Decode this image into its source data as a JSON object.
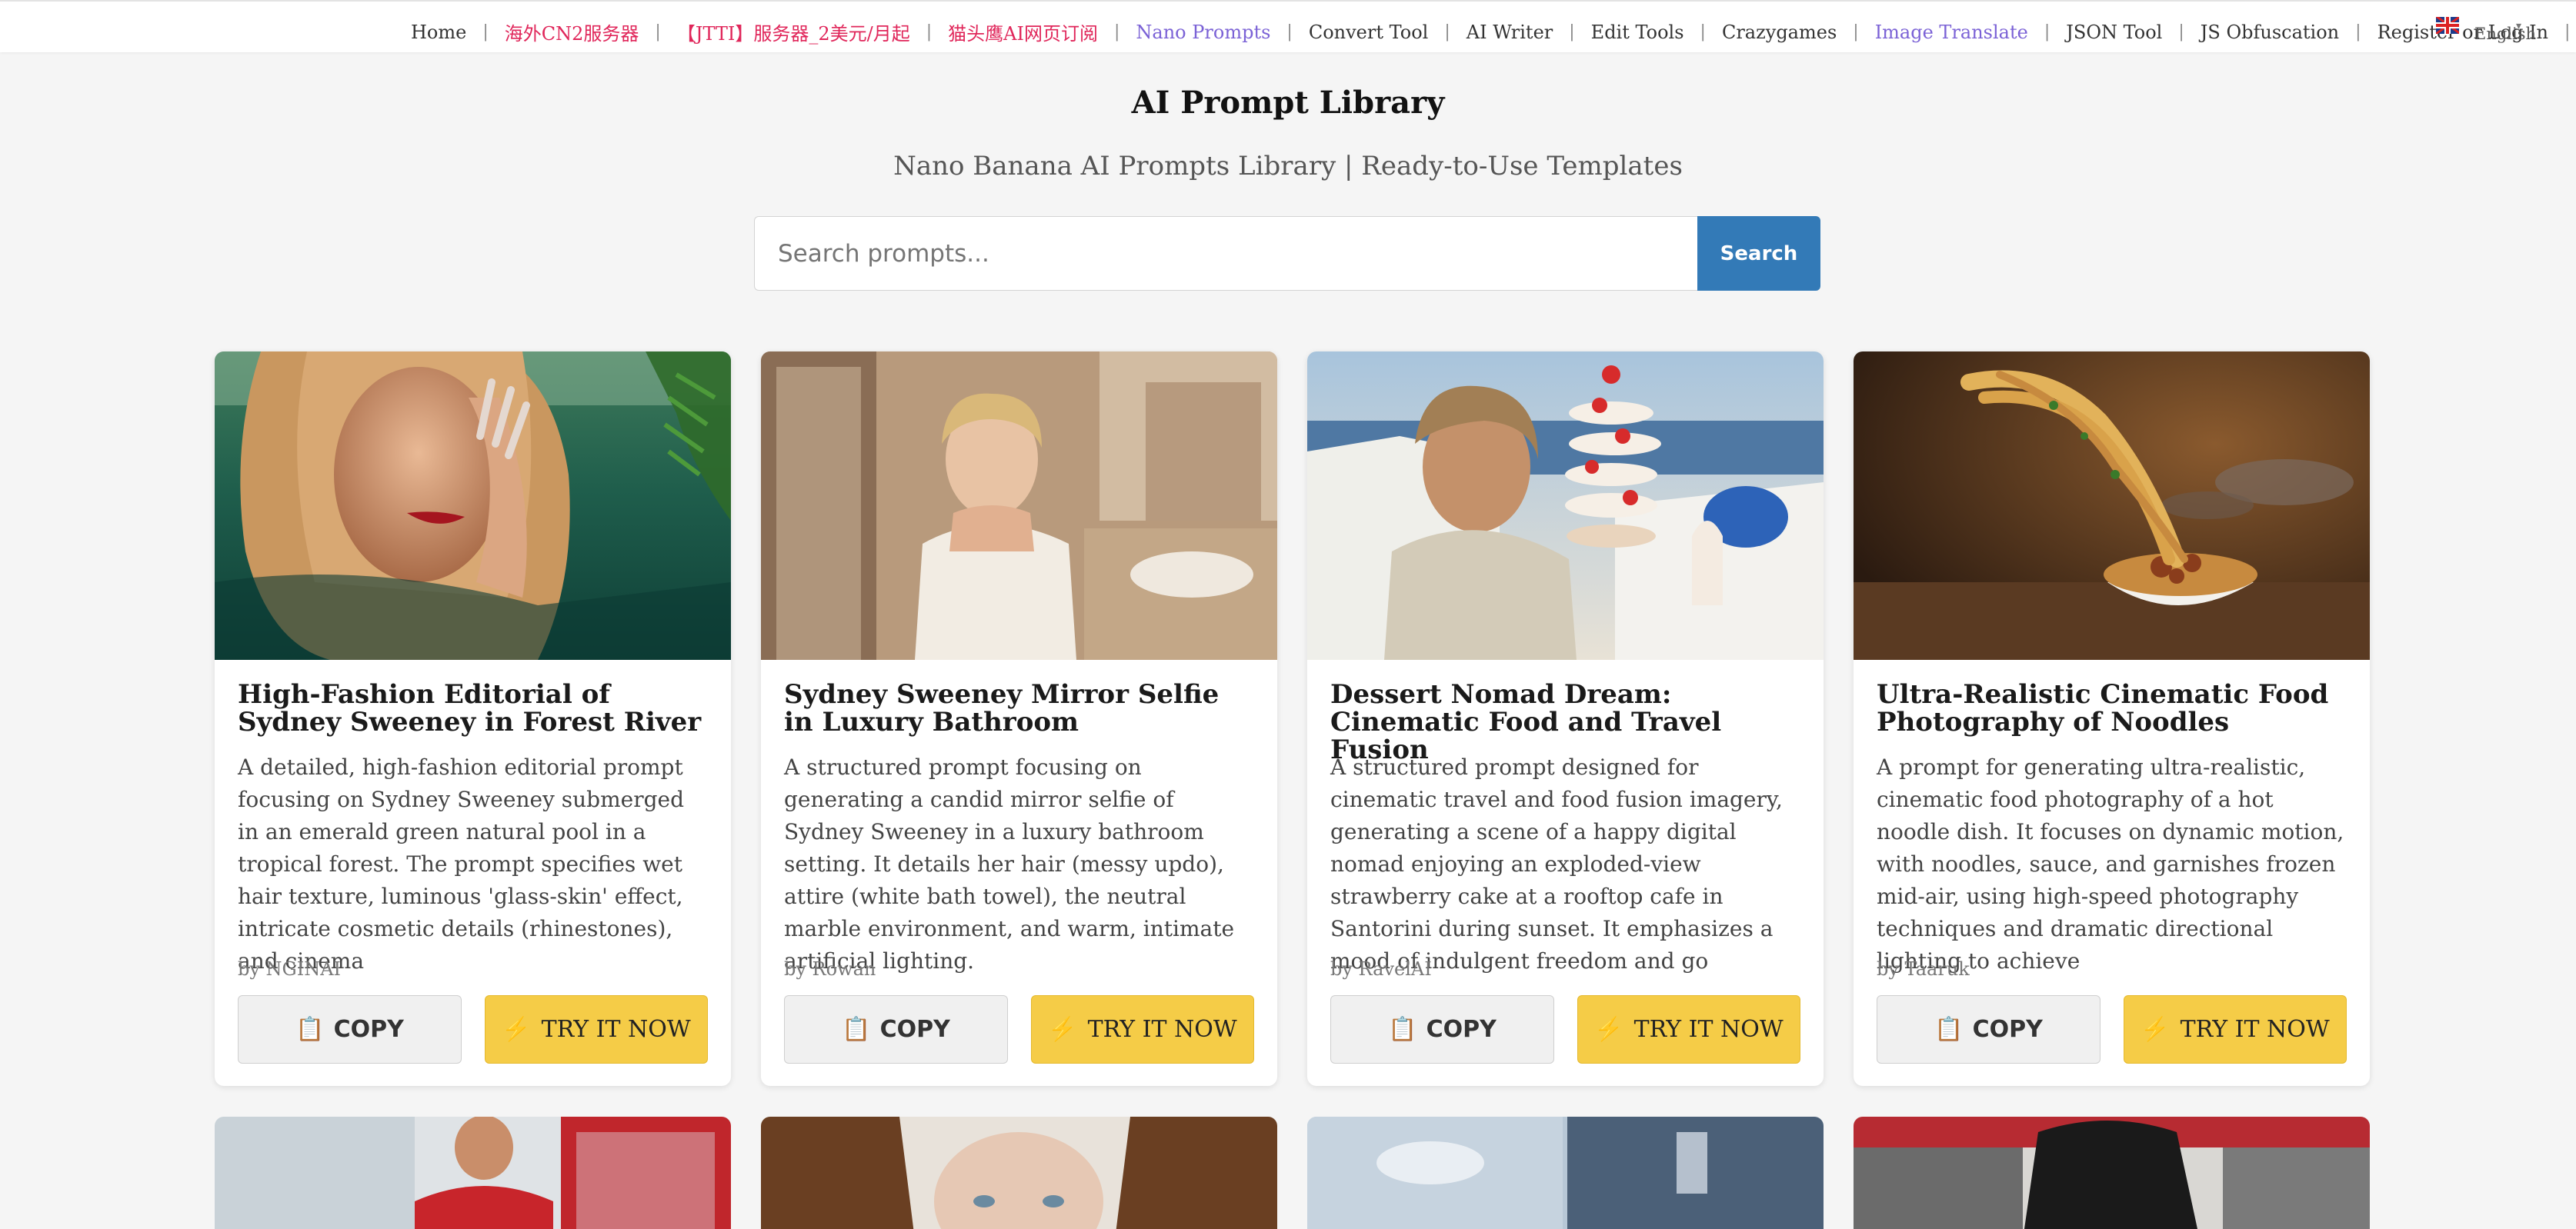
{
  "nav": {
    "items": [
      {
        "label": "Home",
        "style": "normal"
      },
      {
        "label": "海外CN2服务器",
        "style": "red"
      },
      {
        "label": "【JTTI】服务器_2美元/月起",
        "style": "red"
      },
      {
        "label": "猫头鹰AI网页订阅",
        "style": "red"
      },
      {
        "label": "Nano Prompts",
        "style": "purple"
      },
      {
        "label": "Convert Tool",
        "style": "normal"
      },
      {
        "label": "AI Writer",
        "style": "normal"
      },
      {
        "label": "Edit Tools",
        "style": "normal"
      },
      {
        "label": "Crazygames",
        "style": "normal"
      },
      {
        "label": "Image Translate",
        "style": "purple"
      },
      {
        "label": "JSON Tool",
        "style": "normal"
      },
      {
        "label": "JS Obfuscation",
        "style": "normal"
      },
      {
        "label": "Register or Log In",
        "style": "normal"
      }
    ],
    "separator": "|",
    "language": "English",
    "flag_icon": "uk-flag-icon"
  },
  "header": {
    "title": "AI Prompt Library",
    "subtitle": "Nano Banana AI Prompts Library | Ready-to-Use Templates"
  },
  "search": {
    "placeholder": "Search prompts...",
    "value": "",
    "button_label": "Search"
  },
  "colors": {
    "accent_red": "#e0265a",
    "accent_purple": "#7b62d6",
    "search_blue": "#337ab7",
    "try_yellow": "#f5cc47"
  },
  "buttons": {
    "copy_label": "COPY",
    "copy_icon": "clipboard-icon",
    "try_label": "TRY IT NOW",
    "try_icon": "lightning-bolt-icon"
  },
  "cards": [
    {
      "title": "High-Fashion Editorial of Sydney Sweeney in Forest River",
      "description": "A detailed, high-fashion editorial prompt focusing on Sydney Sweeney submerged in an emerald green natural pool in a tropical forest. The prompt specifies wet hair texture, luminous 'glass-skin' effect, intricate cosmetic details (rhinestones), and cinema",
      "author": "by NGINAI"
    },
    {
      "title": "Sydney Sweeney Mirror Selfie in Luxury Bathroom",
      "description": "A structured prompt focusing on generating a candid mirror selfie of Sydney Sweeney in a luxury bathroom setting. It details her hair (messy updo), attire (white bath towel), the neutral marble environment, and warm, intimate artificial lighting.",
      "author": "by Rowan"
    },
    {
      "title": "Dessert Nomad Dream: Cinematic Food and Travel Fusion",
      "description": "A structured prompt designed for cinematic travel and food fusion imagery, generating a scene of a happy digital nomad enjoying an exploded-view strawberry cake at a rooftop cafe in Santorini during sunset. It emphasizes a mood of indulgent freedom and go",
      "author": "by RavelAI"
    },
    {
      "title": "Ultra-Realistic Cinematic Food Photography of Noodles",
      "description": "A prompt for generating ultra-realistic, cinematic food photography of a hot noodle dish. It focuses on dynamic motion, with noodles, sauce, and garnishes frozen mid-air, using high-speed photography techniques and dramatic directional lighting to achieve",
      "author": "by Taaruk"
    }
  ]
}
